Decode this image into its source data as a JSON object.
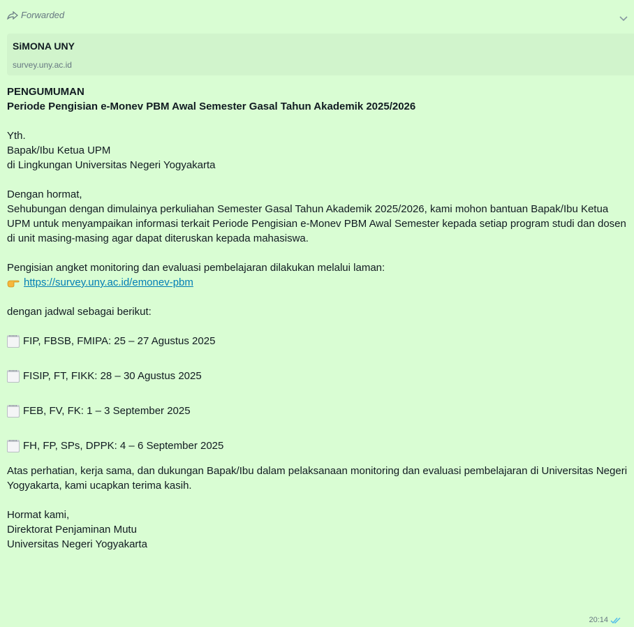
{
  "forwarded_label": "Forwarded",
  "link_preview": {
    "title": "SiMONA UNY",
    "domain": "survey.uny.ac.id"
  },
  "message": {
    "heading": "PENGUMUMAN",
    "subheading": "Periode Pengisian e-Monev PBM Awal Semester Gasal Tahun Akademik 2025/2026",
    "greeting": [
      "Yth.",
      "Bapak/Ibu Ketua UPM",
      "di Lingkungan Universitas Negeri Yogyakarta"
    ],
    "opening": "Dengan hormat,",
    "body": "Sehubungan dengan dimulainya perkuliahan Semester Gasal Tahun Akademik 2025/2026, kami mohon bantuan Bapak/Ibu Ketua UPM untuk menyampaikan informasi terkait Periode Pengisian e-Monev PBM Awal Semester kepada setiap program studi dan dosen di unit masing-masing agar dapat diteruskan kepada mahasiswa.",
    "link_intro": "Pengisian angket monitoring dan evaluasi pembelajaran dilakukan melalui laman:",
    "link_url": "https://survey.uny.ac.id/emonev-pbm",
    "schedule_intro": "dengan jadwal sebagai berikut:",
    "schedule": [
      "FIP, FBSB, FMIPA: 25 – 27 Agustus 2025",
      "FISIP, FT, FIKK: 28 – 30 Agustus 2025",
      "FEB, FV, FK: 1 – 3 September 2025",
      "FH, FP, SPs, DPPK: 4 – 6 September 2025"
    ],
    "closing": "Atas perhatian, kerja sama, dan dukungan Bapak/Ibu dalam pelaksanaan monitoring dan evaluasi pembelajaran di Universitas Negeri Yogyakarta, kami ucapkan terima kasih.",
    "signature": [
      "Hormat kami,",
      "Direktorat Penjaminan Mutu",
      "Universitas Negeri Yogyakarta"
    ]
  },
  "timestamp": "20:14",
  "icons": {
    "forwarded": "forward-arrow-icon",
    "menu": "chevron-down-icon",
    "pointer": "pointing-hand-icon",
    "calendar": "calendar-icon",
    "read": "double-check-icon"
  },
  "colors": {
    "bubble": "#d9fdd3",
    "preview": "#d1f4cc",
    "link": "#027eb5",
    "read_ticks": "#53bdeb"
  }
}
